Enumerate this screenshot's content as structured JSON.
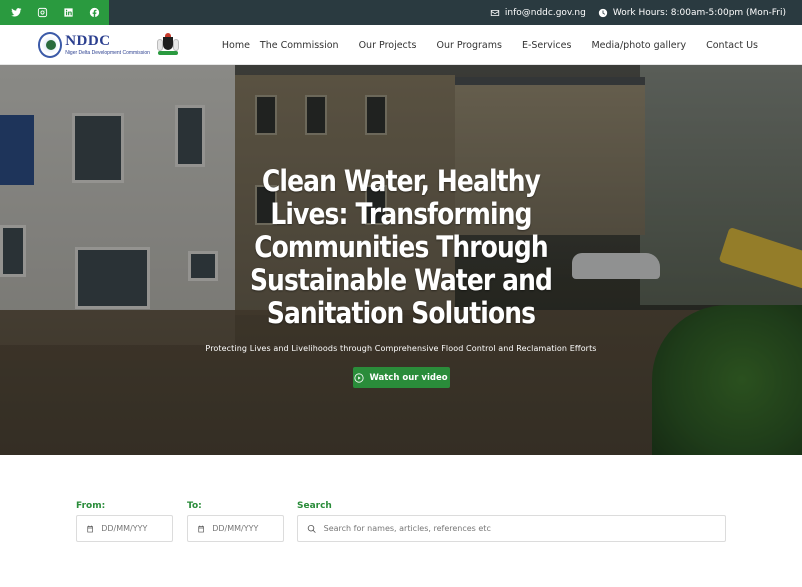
{
  "topbar": {
    "social": [
      {
        "icon": "twitter-icon"
      },
      {
        "icon": "instagram-icon"
      },
      {
        "icon": "linkedin-icon"
      },
      {
        "icon": "facebook-icon"
      }
    ],
    "email": "info@nddc.gov.ng",
    "hours": "Work Hours: 8:00am-5:00pm (Mon-Fri)"
  },
  "header": {
    "logo_title": "NDDC",
    "logo_subtitle": "Niger Delta Development Commission",
    "nav": [
      "Home",
      "The Commission",
      "Our Projects",
      "Our Programs",
      "E-Services",
      "Media/photo gallery",
      "Contact Us"
    ]
  },
  "hero": {
    "title": "Clean Water, Healthy Lives: Transforming Communities Through Sustainable Water and Sanitation Solutions",
    "subtitle": "Protecting Lives and Livelihoods through Comprehensive Flood Control and Reclamation Efforts",
    "button": "Watch our video"
  },
  "search": {
    "from_label": "From:",
    "to_label": "To:",
    "search_label": "Search",
    "from_placeholder": "DD/MM/YYY",
    "to_placeholder": "DD/MM/YYY",
    "search_placeholder": "Search for names, articles, references etc"
  },
  "colors": {
    "topbar_bg": "#2a3a40",
    "accent_green": "#2a9a3f",
    "button_green": "#2a8c3a",
    "logo_blue": "#2b3f8f"
  }
}
